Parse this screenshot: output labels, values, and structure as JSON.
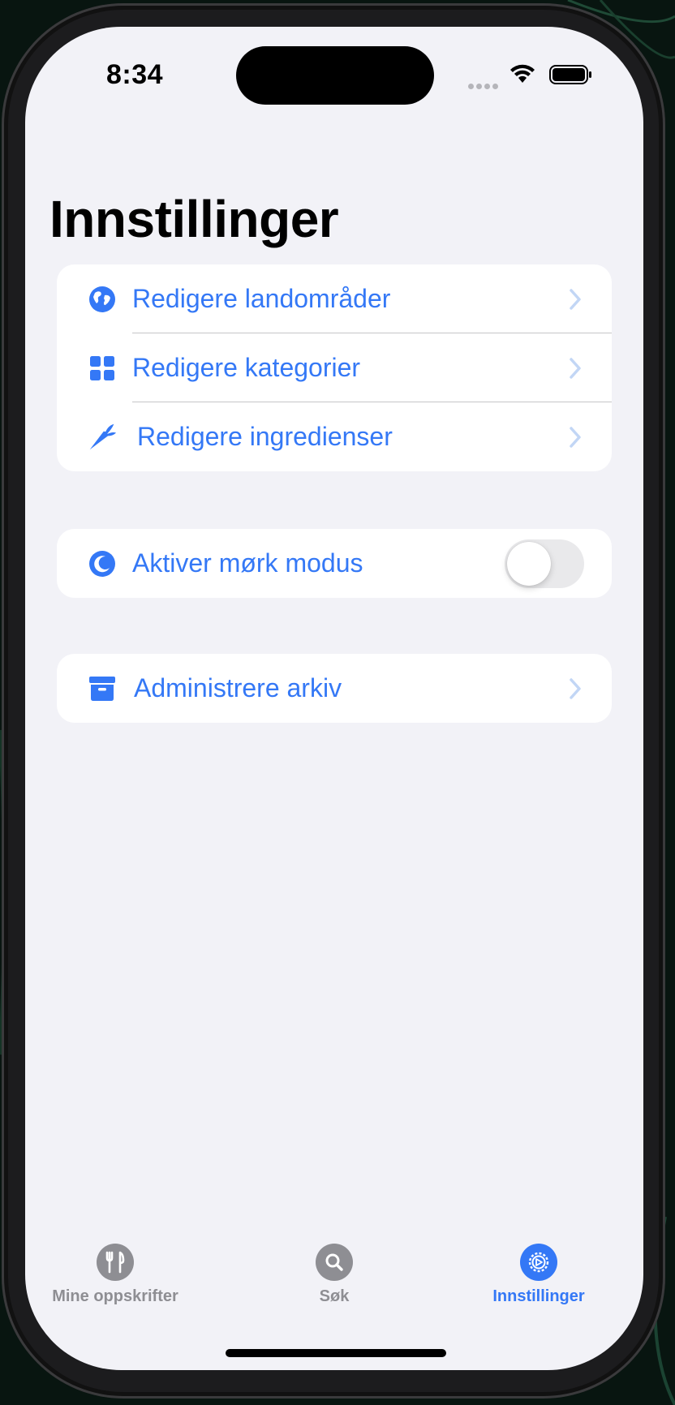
{
  "status_bar": {
    "time": "8:34"
  },
  "page": {
    "title": "Innstillinger"
  },
  "settings_group_1": {
    "items": [
      {
        "label": "Redigere landområder",
        "icon": "globe-icon"
      },
      {
        "label": "Redigere kategorier",
        "icon": "grid-icon"
      },
      {
        "label": "Redigere ingredienser",
        "icon": "carrot-icon"
      }
    ]
  },
  "settings_group_2": {
    "dark_mode": {
      "label": "Aktiver mørk modus",
      "icon": "moon-icon",
      "enabled": false
    }
  },
  "settings_group_3": {
    "archive": {
      "label": "Administrere arkiv",
      "icon": "archive-box-icon"
    }
  },
  "tab_bar": {
    "tabs": [
      {
        "label": "Mine oppskrifter",
        "icon": "fork-knife-icon",
        "active": false
      },
      {
        "label": "Søk",
        "icon": "search-icon",
        "active": false
      },
      {
        "label": "Innstillinger",
        "icon": "gear-icon",
        "active": true
      }
    ]
  },
  "colors": {
    "accent": "#3478f6",
    "background": "#f2f2f7",
    "inactive_tab": "#8e8e93",
    "chevron": "#c2d6f5"
  }
}
